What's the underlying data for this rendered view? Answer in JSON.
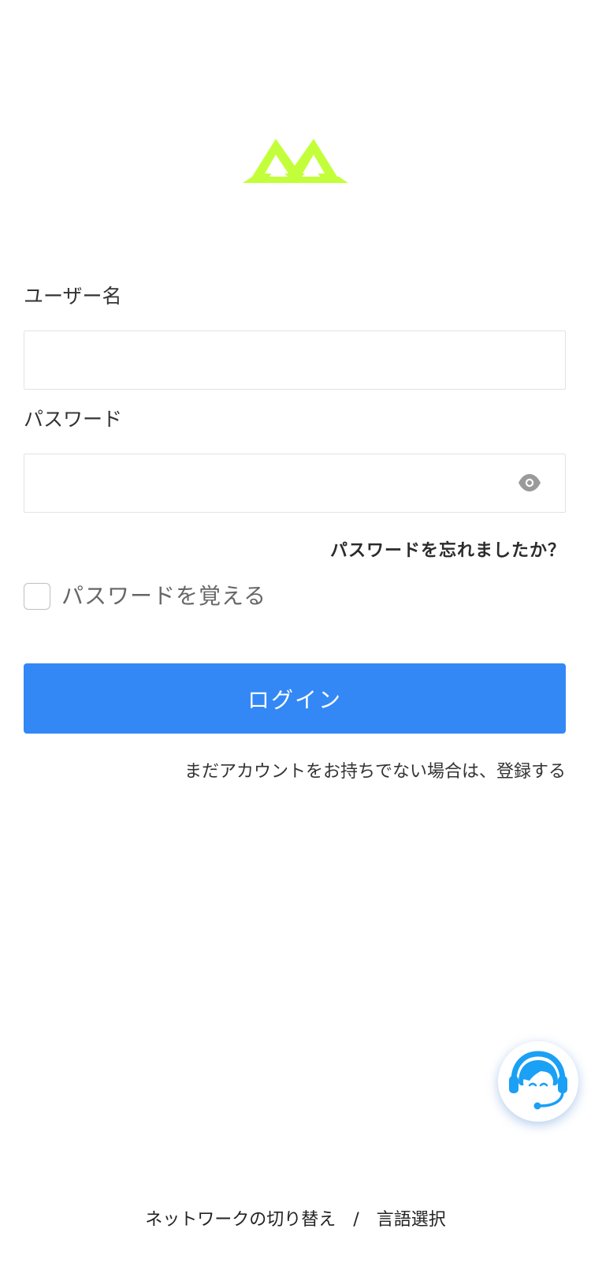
{
  "logo": {
    "name": "logo-icon",
    "color": "#c2ff3a"
  },
  "form": {
    "username_label": "ユーザー名",
    "username_value": "",
    "password_label": "パスワード",
    "password_value": "",
    "forgot_password": "パスワードを忘れましたか？",
    "remember_label": "パスワードを覚える",
    "remember_checked": false,
    "login_button": "ログイン",
    "register_text": "まだアカウントをお持ちでない場合は、登録する"
  },
  "support": {
    "icon": "customer-support-icon",
    "color": "#1aa0f5"
  },
  "footer": {
    "network_switch": "ネットワークの切り替え",
    "separator": "/",
    "language_select": "言語選択"
  },
  "colors": {
    "primary": "#3388f5",
    "logo_accent": "#c2ff3a",
    "support_blue": "#1aa0f5"
  }
}
